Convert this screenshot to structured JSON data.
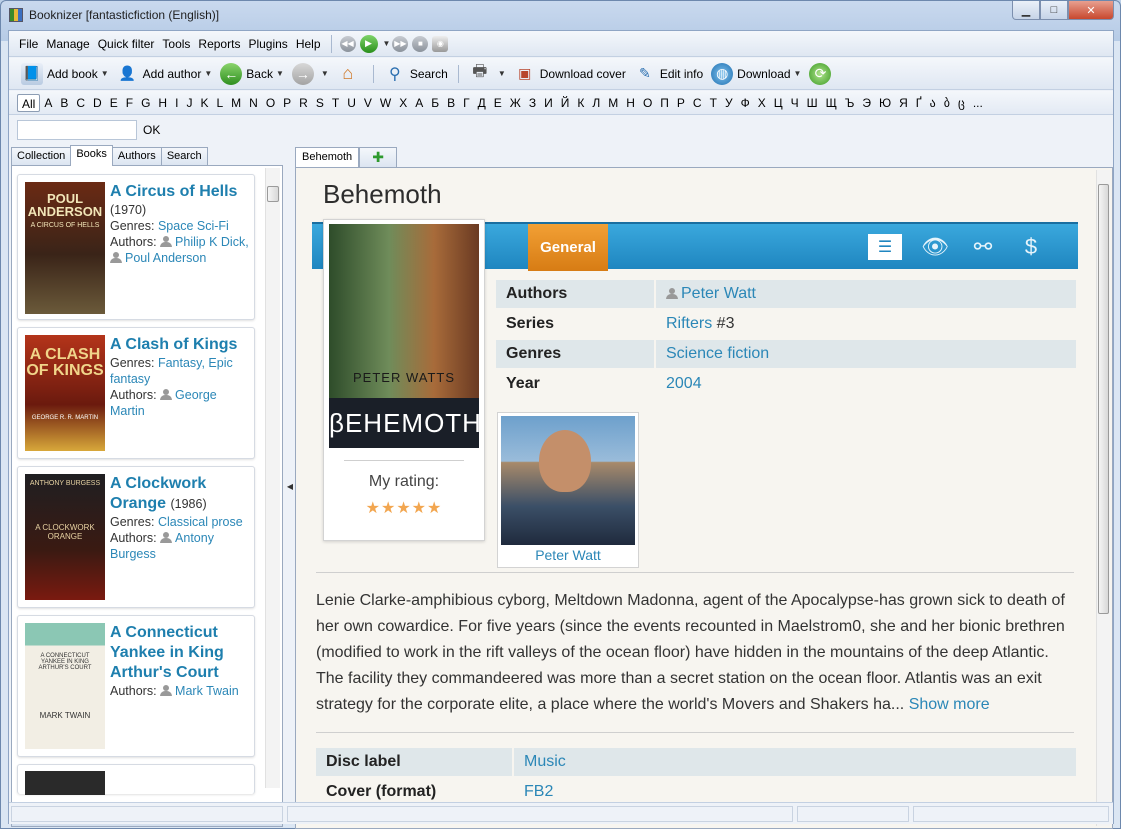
{
  "window": {
    "title": "Booknizer [fantasticfiction (English)]"
  },
  "menu": {
    "items": [
      "File",
      "Manage",
      "Quick filter",
      "Tools",
      "Reports",
      "Plugins",
      "Help"
    ]
  },
  "toolbar": {
    "add_book": "Add book",
    "add_author": "Add author",
    "back": "Back",
    "search": "Search",
    "download_cover": "Download cover",
    "edit_info": "Edit info",
    "download": "Download"
  },
  "alphabet": [
    "All",
    "A",
    "B",
    "C",
    "D",
    "E",
    "F",
    "G",
    "H",
    "I",
    "J",
    "K",
    "L",
    "M",
    "N",
    "O",
    "P",
    "R",
    "S",
    "T",
    "U",
    "V",
    "W",
    "X",
    "А",
    "Б",
    "В",
    "Г",
    "Д",
    "Е",
    "Ж",
    "З",
    "И",
    "Й",
    "К",
    "Л",
    "М",
    "Н",
    "О",
    "П",
    "Р",
    "С",
    "Т",
    "У",
    "Ф",
    "Х",
    "Ц",
    "Ч",
    "Ш",
    "Щ",
    "Ъ",
    "Э",
    "Ю",
    "Я",
    "Ґ",
    "ა",
    "ბ",
    "ც",
    "..."
  ],
  "filter": {
    "ok_label": "OK"
  },
  "left_tabs": [
    "Collection",
    "Books",
    "Authors",
    "Search"
  ],
  "books": [
    {
      "title": "A Circus of Hells",
      "year": "(1970)",
      "genres_label": "Genres:",
      "genres": "Space Sci-Fi",
      "authors_label": "Authors:",
      "author1": "Philip K Dick,",
      "author2": "Poul Anderson",
      "cover_top": "POUL ANDERSON",
      "cover_sub": "A CIRCUS OF HELLS"
    },
    {
      "title": "A Clash of Kings",
      "genres_label": "Genres:",
      "genres": "Fantasy, Epic fantasy",
      "authors_label": "Authors:",
      "author1": "George Martin",
      "cover_top": "A CLASH OF KINGS",
      "cover_sub": "GEORGE R. R. MARTIN"
    },
    {
      "title": "A Clockwork Orange",
      "year": "(1986)",
      "genres_label": "Genres:",
      "genres": "Classical prose",
      "authors_label": "Authors:",
      "author1": "Antony Burgess",
      "cover_top": "ANTHONY BURGESS",
      "cover_sub": "A CLOCKWORK ORANGE"
    },
    {
      "title": "A Connecticut Yankee in King Arthur's Court",
      "authors_label": "Authors:",
      "author1": "Mark Twain",
      "cover_top": "A CONNECTICUT YANKEE IN KING ARTHUR'S COURT",
      "cover_sub": "MARK TWAIN"
    }
  ],
  "right_tab": "Behemoth",
  "book": {
    "title": "Behemoth",
    "section_tab": "General",
    "cover_author": "PETER WATTS",
    "cover_title": "βEHEMOTH",
    "my_rating_label": "My rating:",
    "stars": "★★★★★",
    "props": [
      {
        "key": "Authors",
        "value": "Peter Watt",
        "extra": ""
      },
      {
        "key": "Series",
        "value": "Rifters",
        "extra": " #3"
      },
      {
        "key": "Genres",
        "value": "Science fiction",
        "extra": ""
      },
      {
        "key": "Year",
        "value": "2004",
        "extra": ""
      }
    ],
    "author_photo_name": "Peter Watt",
    "description": "Lenie Clarke-amphibious cyborg, Meltdown Madonna, agent of the Apocalypse-has grown sick to death of her own cowardice. For five years (since the events recounted in Maelstrom0, she and her bionic brethren (modified to work in the rift valleys of the ocean floor) have hidden in the mountains of the deep Atlantic. The facility they commandeered was more than a secret station on the ocean floor. Atlantis was an exit strategy for the corporate elite, a place where the world's Movers and Shakers ha...",
    "show_more": "Show more",
    "props2": [
      {
        "key": "Disc label",
        "value": "Music"
      },
      {
        "key": "Cover (format)",
        "value": "FB2"
      }
    ]
  }
}
